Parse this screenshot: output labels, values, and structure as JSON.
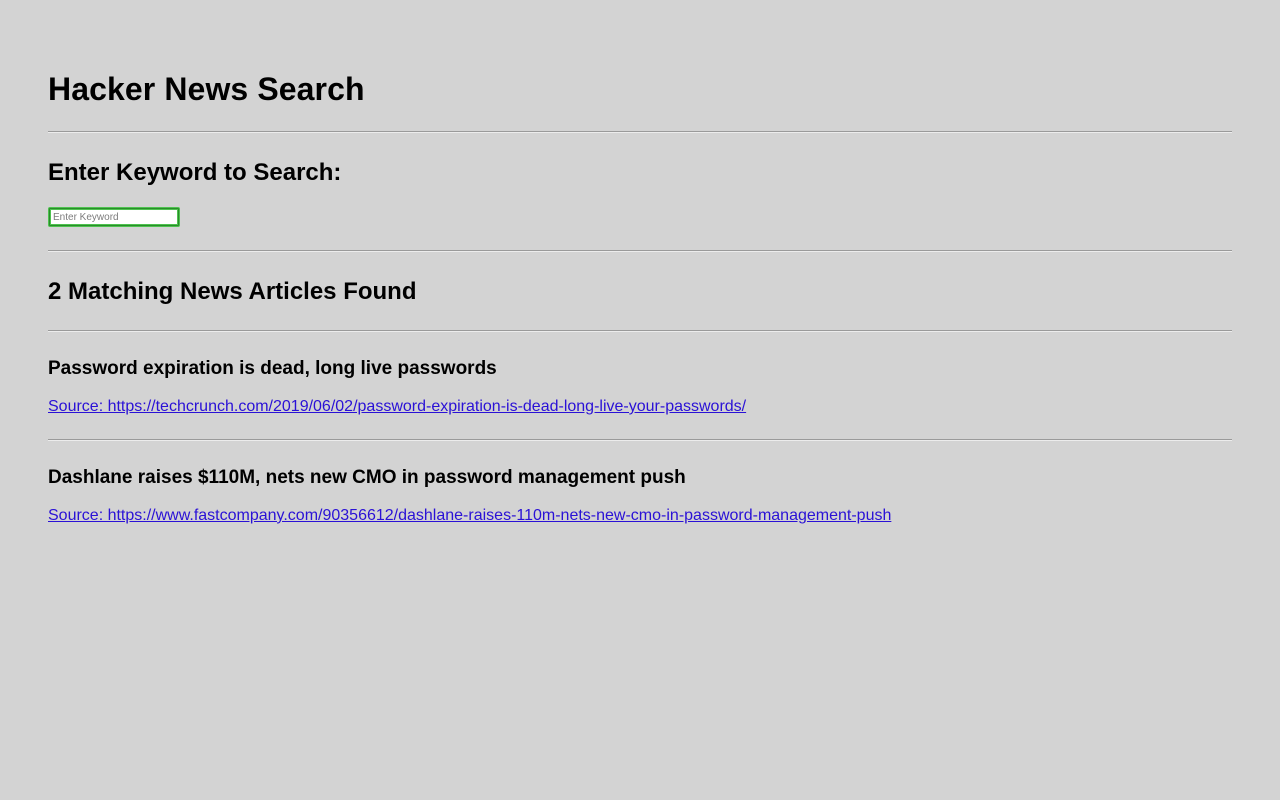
{
  "page": {
    "title": "Hacker News Search",
    "search_heading": "Enter Keyword to Search:",
    "search_placeholder": "Enter Keyword",
    "search_value": "",
    "results_heading": "2 Matching News Articles Found"
  },
  "articles": [
    {
      "title": "Password expiration is dead, long live passwords",
      "source": "Source: https://techcrunch.com/2019/06/02/password-expiration-is-dead-long-live-your-passwords/"
    },
    {
      "title": "Dashlane raises $110M, nets new CMO in password management push",
      "source": "Source: https://www.fastcompany.com/90356612/dashlane-raises-110m-nets-new-cmo-in-password-management-push"
    }
  ],
  "colors": {
    "background": "#d3d3d3",
    "link": "#2a11d6",
    "focus_ring": "#4ec24f"
  }
}
